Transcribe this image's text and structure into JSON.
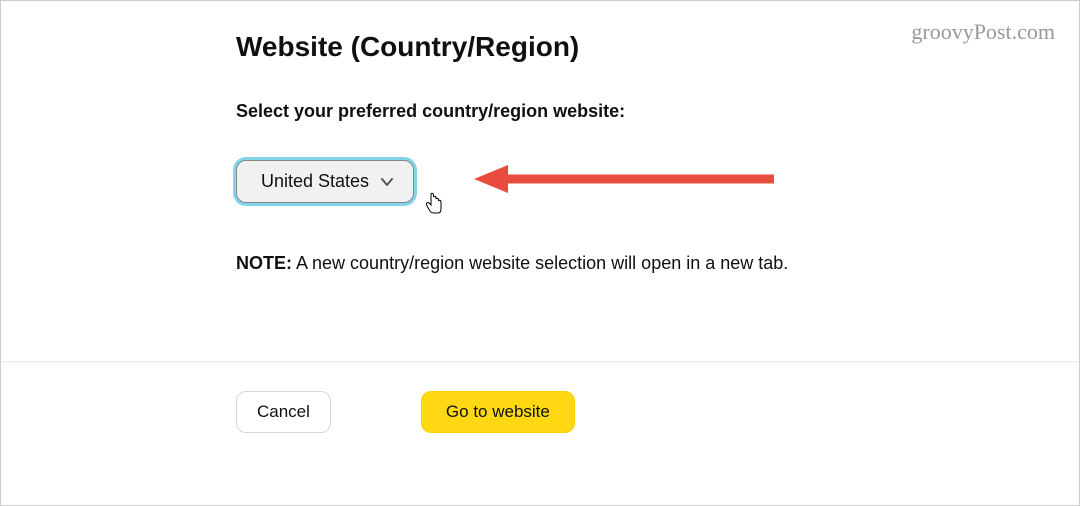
{
  "header": {
    "title": "Website (Country/Region)"
  },
  "main": {
    "instruction": "Select your preferred country/region website:",
    "dropdown": {
      "selected": "United States"
    },
    "note_label": "NOTE:",
    "note_text": " A new country/region website selection will open in a new tab."
  },
  "actions": {
    "cancel_label": "Cancel",
    "go_label": "Go to website"
  },
  "watermark": "groovyPost.com",
  "annotation": {
    "arrow_color": "#e74c3c"
  }
}
